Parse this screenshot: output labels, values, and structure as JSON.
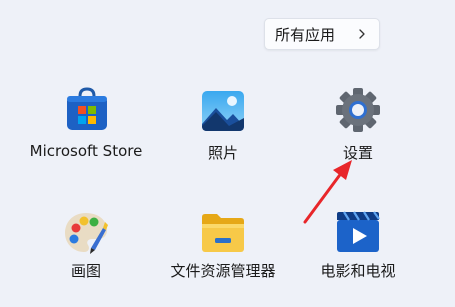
{
  "header": {
    "all_apps_label": "所有应用"
  },
  "pinned_apps": [
    {
      "label": "Microsoft Store",
      "icon": "microsoft-store-icon"
    },
    {
      "label": "照片",
      "icon": "photos-icon"
    },
    {
      "label": "设置",
      "icon": "settings-gear-icon"
    },
    {
      "label": "画图",
      "icon": "paint-palette-icon"
    },
    {
      "label": "文件资源管理器",
      "icon": "file-explorer-folder-icon"
    },
    {
      "label": "电影和电视",
      "icon": "movies-tv-icon"
    }
  ],
  "annotation": {
    "arrow_color": "#e8262a"
  }
}
